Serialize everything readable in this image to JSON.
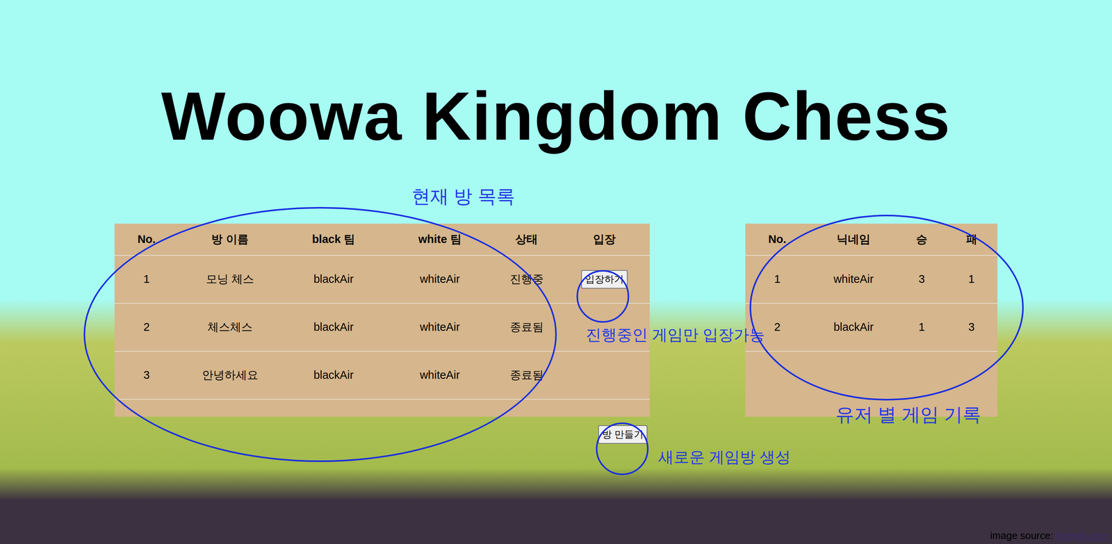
{
  "title": "Woowa Kingdom Chess",
  "rooms_table": {
    "columns": [
      "No.",
      "방 이름",
      "black 팀",
      "white 팀",
      "상태",
      "입장"
    ],
    "enter_label": "입장하기",
    "rows": [
      {
        "no": "1",
        "name": "모닝 체스",
        "black": "blackAir",
        "white": "whiteAir",
        "status": "진행중",
        "enterable": true
      },
      {
        "no": "2",
        "name": "체스체스",
        "black": "blackAir",
        "white": "whiteAir",
        "status": "종료됨",
        "enterable": false
      },
      {
        "no": "3",
        "name": "안녕하세요",
        "black": "blackAir",
        "white": "whiteAir",
        "status": "종료됨",
        "enterable": false
      }
    ]
  },
  "create_button": "방 만들기",
  "users_table": {
    "columns": [
      "No.",
      "닉네임",
      "승",
      "패"
    ],
    "rows": [
      {
        "no": "1",
        "nickname": "whiteAir",
        "wins": "3",
        "losses": "1"
      },
      {
        "no": "2",
        "nickname": "blackAir",
        "wins": "1",
        "losses": "3"
      }
    ]
  },
  "annotations": [
    "현재 방 목록",
    "진행중인 게임만 입장가능",
    "새로운 게임방 생성",
    "유저 별 게임 기록"
  ],
  "credit": {
    "label": "image source: ",
    "link": "freepik.com"
  }
}
